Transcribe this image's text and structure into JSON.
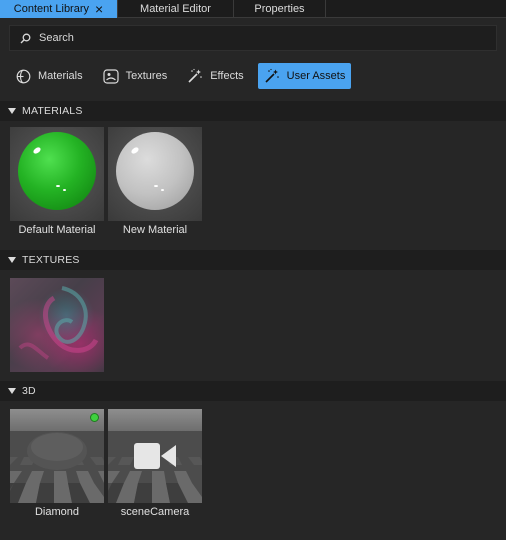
{
  "tabs": [
    {
      "label": "Content Library",
      "active": true
    },
    {
      "label": "Material Editor",
      "active": false
    },
    {
      "label": "Properties",
      "active": false
    }
  ],
  "search": {
    "placeholder": "Search",
    "value": ""
  },
  "categories": [
    {
      "label": "Materials",
      "icon": "sphere-icon",
      "active": false
    },
    {
      "label": "Textures",
      "icon": "image-icon",
      "active": false
    },
    {
      "label": "Effects",
      "icon": "magic-wand-icon",
      "active": false
    },
    {
      "label": "User Assets",
      "icon": "magic-wand-icon",
      "active": true
    }
  ],
  "sections": {
    "materials": {
      "title": "MATERIALS",
      "items": [
        {
          "label": "Default Material",
          "color": "#24b324"
        },
        {
          "label": "New Material",
          "color": "#c2c2c2"
        }
      ]
    },
    "textures": {
      "title": "TEXTURES",
      "items": []
    },
    "three_d": {
      "title": "3D",
      "items": [
        {
          "label": "Diamond"
        },
        {
          "label": "sceneCamera"
        }
      ]
    }
  },
  "colors": {
    "accent": "#4aa3f0",
    "background": "#262626",
    "header": "#1e1e1e",
    "status_dot": "#3fd13f"
  }
}
